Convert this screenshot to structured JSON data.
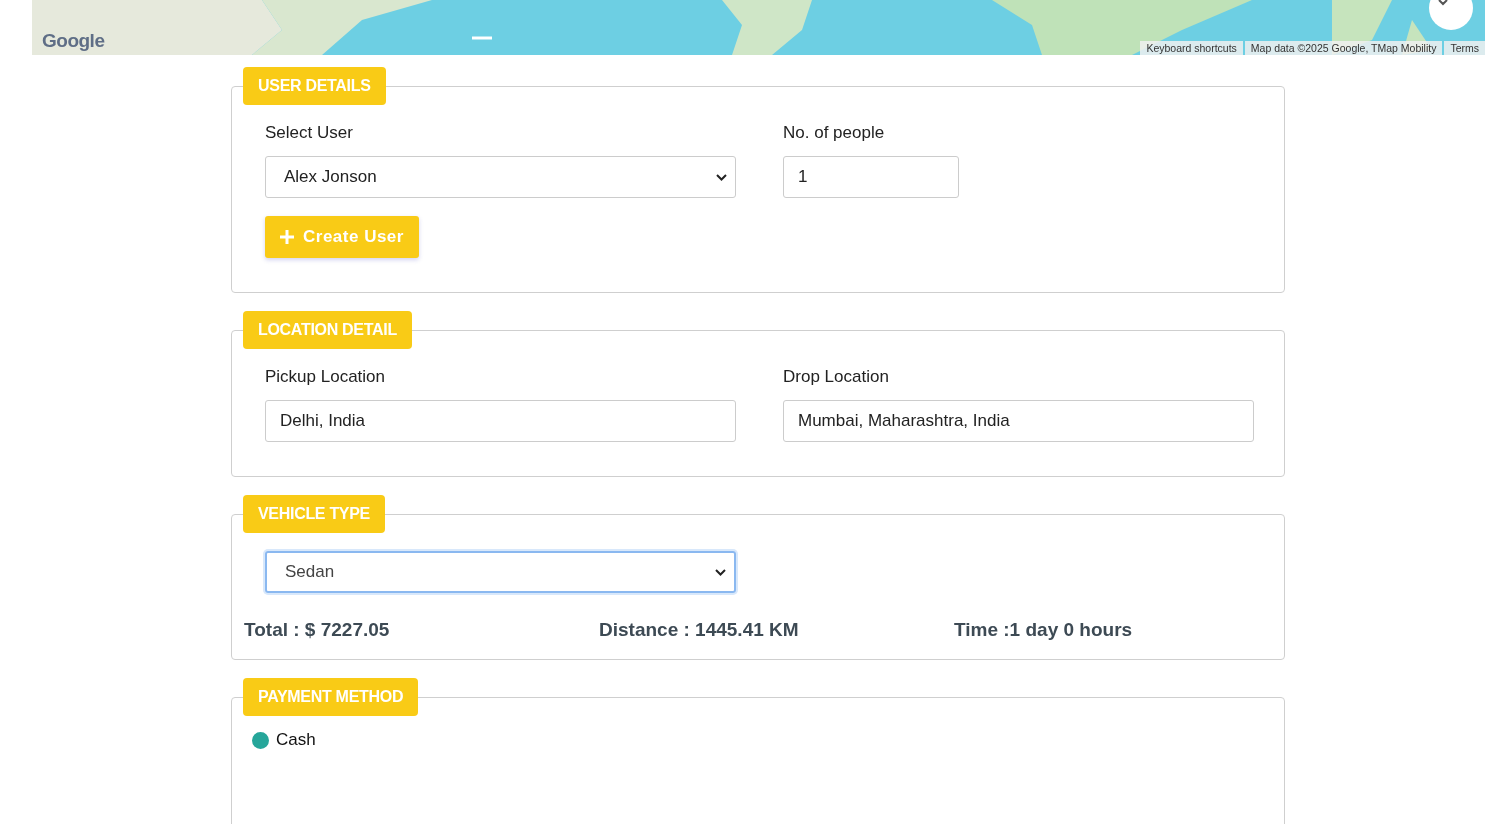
{
  "map": {
    "logo": "Google",
    "attribution": [
      "Keyboard shortcuts",
      "Map data ©2025 Google, TMap Mobility",
      "Terms"
    ]
  },
  "sections": [
    {
      "title": "USER DETAILS",
      "fields": [
        {
          "kind": "select",
          "label": "Select User",
          "value": "Alex Jonson",
          "focused": false
        },
        {
          "kind": "number",
          "label": "No. of people",
          "value": "1",
          "focused": false
        }
      ],
      "button": "Create User"
    },
    {
      "title": "LOCATION DETAIL",
      "fields": [
        {
          "kind": "text",
          "label": "Pickup Location",
          "value": "Delhi, India",
          "focused": false
        },
        {
          "kind": "text",
          "label": "Drop Location",
          "value": "Mumbai, Maharashtra, India",
          "focused": false
        }
      ]
    },
    {
      "title": "VEHICLE TYPE",
      "fields": [
        {
          "kind": "select",
          "value": "Sedan",
          "focused": true
        }
      ],
      "summary": [
        "Total : $ 7227.05",
        "Distance : 1445.41 KM",
        "Time :1 day 0 hours"
      ]
    },
    {
      "title": "PAYMENT METHOD",
      "options": [
        {
          "label": "Cash",
          "checked": true
        }
      ]
    }
  ]
}
